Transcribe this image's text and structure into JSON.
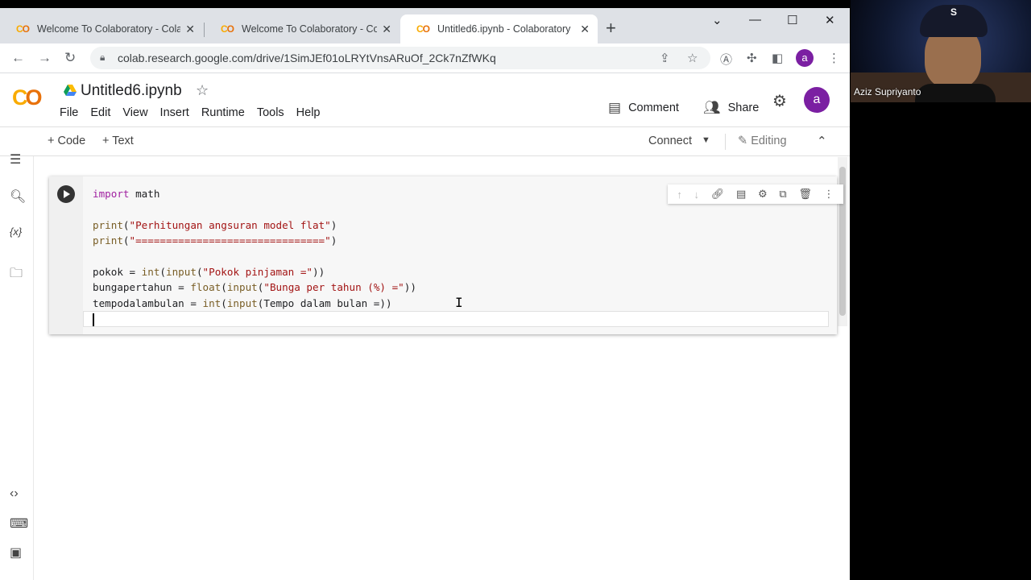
{
  "browser": {
    "tabs": [
      {
        "title": "Welcome To Colaboratory - Colab",
        "active": false
      },
      {
        "title": "Welcome To Colaboratory - Colab",
        "active": false
      },
      {
        "title": "Untitled6.ipynb - Colaboratory",
        "active": true
      }
    ],
    "url": "colab.research.google.com/drive/1SimJEf01oLRYtVnsARuOf_2Ck7nZfWKq",
    "profile_initial": "a"
  },
  "colab": {
    "notebook_title": "Untitled6.ipynb",
    "menu": [
      "File",
      "Edit",
      "View",
      "Insert",
      "Runtime",
      "Tools",
      "Help"
    ],
    "comment_label": "Comment",
    "share_label": "Share",
    "avatar_initial": "a",
    "add_code_label": "+ Code",
    "add_text_label": "+ Text",
    "connect_label": "Connect",
    "editing_label": "Editing"
  },
  "cell": {
    "lines": [
      "import math",
      "",
      "print(\"Perhitungan angsuran model flat\")",
      "print(\"===============================\")",
      "",
      "pokok = int(input(\"Pokok pinjaman =\"))",
      "bungapertahun = float(input(\"Bunga per tahun (%) =\"))",
      "tempodalambulan = int(input(Tempo dalam bulan =))",
      ""
    ]
  },
  "webcam": {
    "name": "Aziz Supriyanto"
  },
  "colors": {
    "colab_orange": "#f9ab00",
    "colab_dark_orange": "#e8710a",
    "avatar_purple": "#7b1fa2",
    "keyword_purple": "#a020a0",
    "string_red": "#a31515",
    "builtin_brown": "#795e26"
  }
}
